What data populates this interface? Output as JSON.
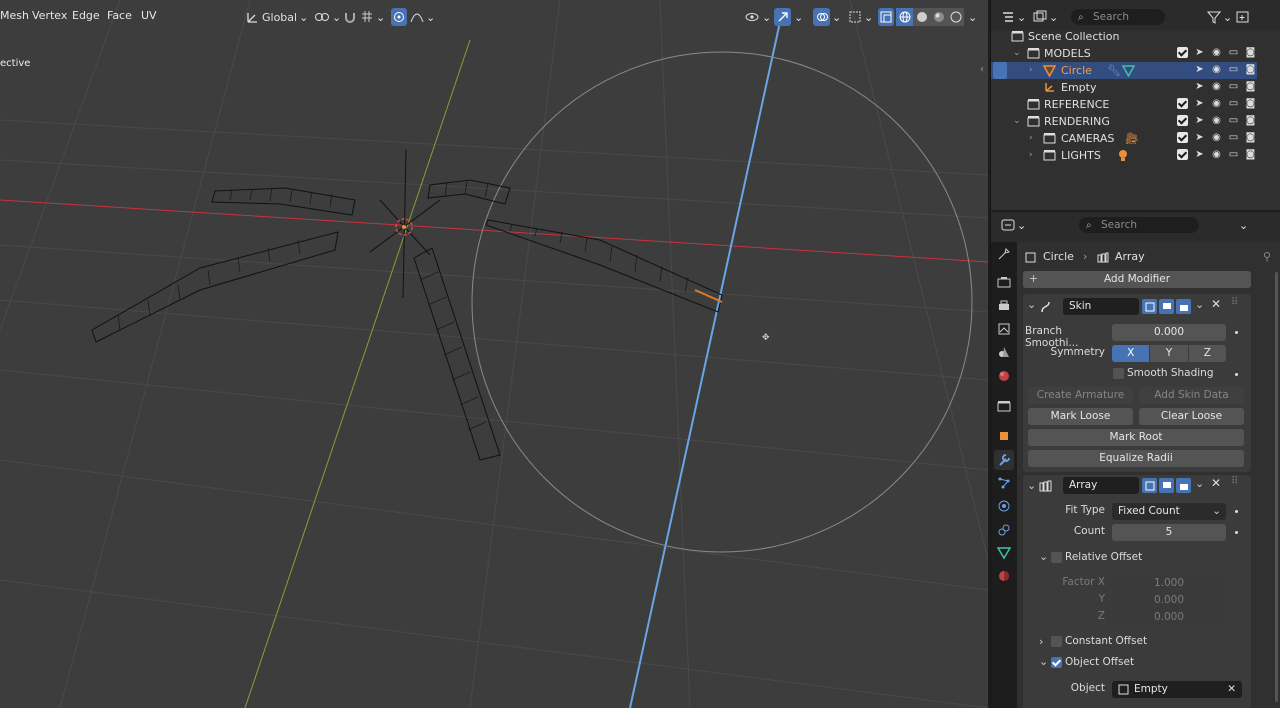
{
  "viewport": {
    "menu": [
      "Mesh",
      "Vertex",
      "Edge",
      "Face",
      "UV"
    ],
    "transform_orientation": "Global",
    "view_label": "ective"
  },
  "outliner": {
    "search_placeholder": "Search",
    "rows": [
      {
        "label": "Scene Collection",
        "type": "scene"
      },
      {
        "label": "MODELS",
        "type": "collection"
      },
      {
        "label": "Circle",
        "type": "mesh",
        "selected": true
      },
      {
        "label": "Empty",
        "type": "empty"
      },
      {
        "label": "REFERENCE",
        "type": "collection"
      },
      {
        "label": "RENDERING",
        "type": "collection"
      },
      {
        "label": "CAMERAS",
        "type": "collection"
      },
      {
        "label": "LIGHTS",
        "type": "collection"
      }
    ]
  },
  "properties": {
    "search_placeholder": "Search",
    "breadcrumb_object": "Circle",
    "breadcrumb_modifier": "Array",
    "add_modifier": "Add Modifier",
    "skin": {
      "name": "Skin",
      "branch_label": "Branch Smoothi...",
      "branch_value": "0.000",
      "symmetry_label": "Symmetry",
      "axes": [
        "X",
        "Y",
        "Z"
      ],
      "smooth_shading": "Smooth Shading",
      "create_armature": "Create Armature",
      "add_skin_data": "Add Skin Data",
      "mark_loose": "Mark Loose",
      "clear_loose": "Clear Loose",
      "mark_root": "Mark Root",
      "equalize_radii": "Equalize Radii"
    },
    "array": {
      "name": "Array",
      "fit_type_label": "Fit Type",
      "fit_type_value": "Fixed Count",
      "count_label": "Count",
      "count_value": "5",
      "relative_offset": "Relative Offset",
      "factor_x_label": "Factor X",
      "factor_x": "1.000",
      "y_label": "Y",
      "y": "0.000",
      "z_label": "Z",
      "z": "0.000",
      "constant_offset": "Constant Offset",
      "object_offset": "Object Offset",
      "object_label": "Object",
      "object_value": "Empty"
    }
  },
  "colors": {
    "accent": "#4772b3",
    "selected_row": "#334d80",
    "x_axis": "#c5353d",
    "y_axis": "#7fa33a",
    "z_axis": "#6aa5e8"
  }
}
